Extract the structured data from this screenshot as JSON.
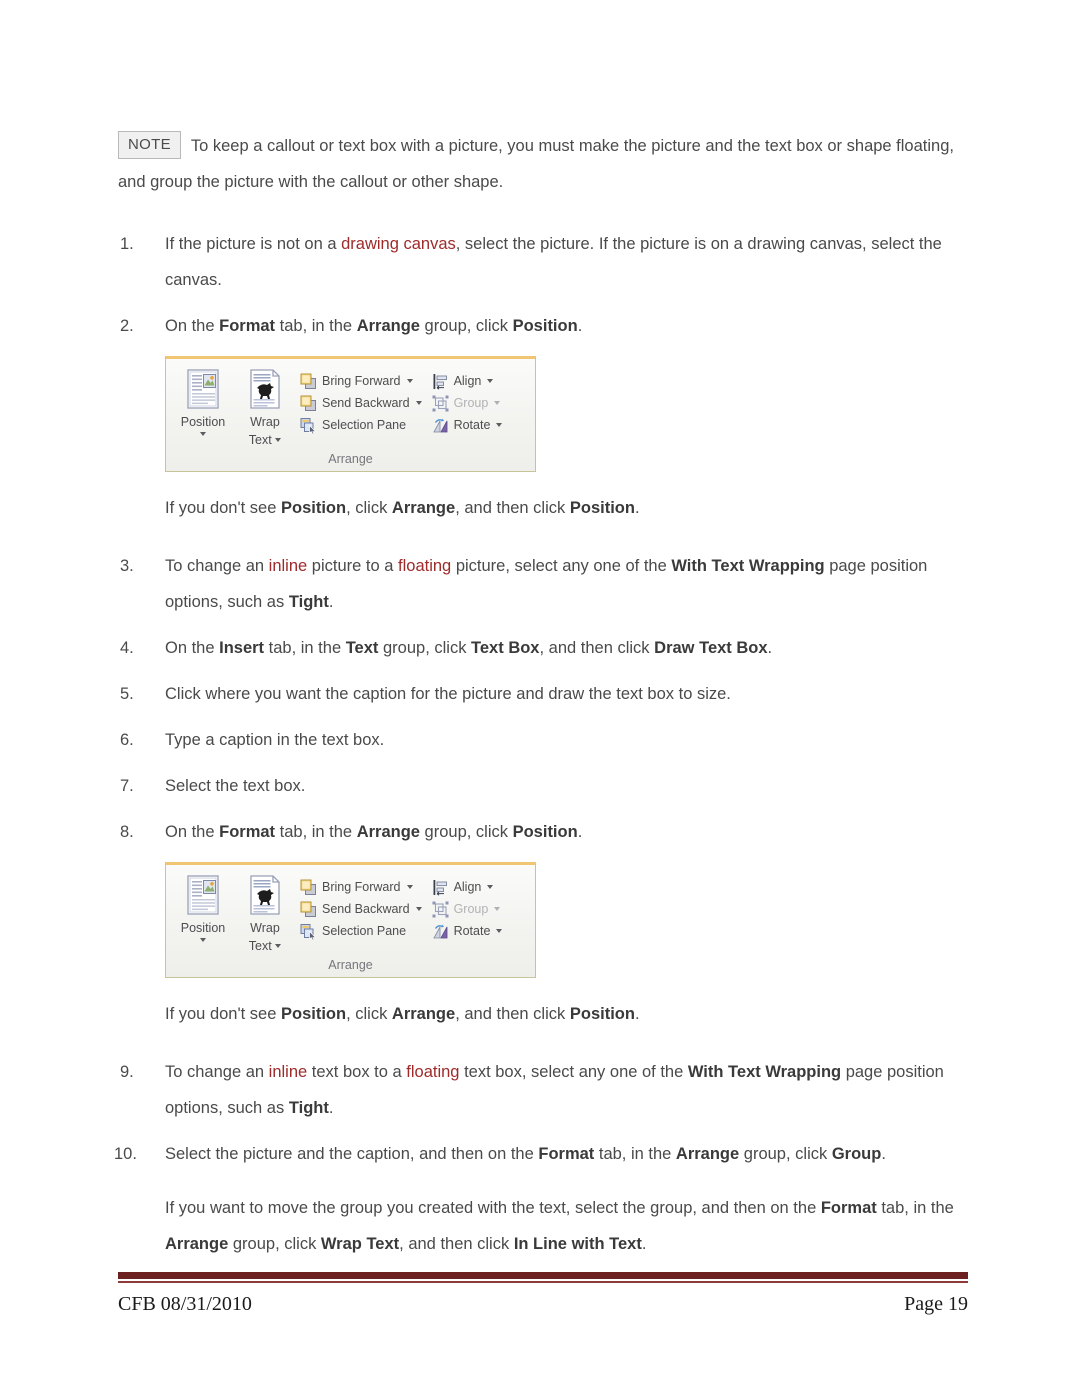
{
  "document": {
    "note": {
      "badge": "NOTE",
      "text": "To keep a callout or text box with a picture, you must make the picture and the text box or shape floating, and group the picture with the callout or other shape."
    },
    "steps": [
      {
        "number": "1.",
        "parts": [
          {
            "t": "If the picture is not on a ",
            "s": "normal"
          },
          {
            "t": "drawing canvas",
            "s": "link"
          },
          {
            "t": ", select the picture. If the picture is on a drawing canvas, select the canvas.",
            "s": "normal"
          }
        ]
      },
      {
        "number": "2.",
        "parts": [
          {
            "t": "On the ",
            "s": "normal"
          },
          {
            "t": "Format",
            "s": "bold"
          },
          {
            "t": " tab, in the ",
            "s": "normal"
          },
          {
            "t": "Arrange",
            "s": "bold"
          },
          {
            "t": " group, click ",
            "s": "normal"
          },
          {
            "t": "Position",
            "s": "bold"
          },
          {
            "t": ".",
            "s": "normal"
          }
        ]
      },
      {
        "number": "3.",
        "parts": [
          {
            "t": "To change an ",
            "s": "normal"
          },
          {
            "t": "inline",
            "s": "link"
          },
          {
            "t": " picture to a ",
            "s": "normal"
          },
          {
            "t": "floating",
            "s": "link"
          },
          {
            "t": " picture, select any one of the ",
            "s": "normal"
          },
          {
            "t": "With Text Wrapping",
            "s": "bold"
          },
          {
            "t": " page position options, such as ",
            "s": "normal"
          },
          {
            "t": "Tight",
            "s": "bold"
          },
          {
            "t": ".",
            "s": "normal"
          }
        ]
      },
      {
        "number": "4.",
        "parts": [
          {
            "t": "On the ",
            "s": "normal"
          },
          {
            "t": "Insert",
            "s": "bold"
          },
          {
            "t": " tab, in the ",
            "s": "normal"
          },
          {
            "t": "Text",
            "s": "bold"
          },
          {
            "t": " group, click ",
            "s": "normal"
          },
          {
            "t": "Text Box",
            "s": "bold"
          },
          {
            "t": ", and then click ",
            "s": "normal"
          },
          {
            "t": "Draw Text Box",
            "s": "bold"
          },
          {
            "t": ".",
            "s": "normal"
          }
        ]
      },
      {
        "number": "5.",
        "parts": [
          {
            "t": "Click where you want the caption for the picture and draw the text box to size.",
            "s": "normal"
          }
        ]
      },
      {
        "number": "6.",
        "parts": [
          {
            "t": "Type a caption in the text box.",
            "s": "normal"
          }
        ]
      },
      {
        "number": "7.",
        "parts": [
          {
            "t": "Select the text box.",
            "s": "normal"
          }
        ]
      },
      {
        "number": "8.",
        "parts": [
          {
            "t": "On the ",
            "s": "normal"
          },
          {
            "t": "Format",
            "s": "bold"
          },
          {
            "t": " tab, in the ",
            "s": "normal"
          },
          {
            "t": "Arrange",
            "s": "bold"
          },
          {
            "t": " group, click ",
            "s": "normal"
          },
          {
            "t": "Position",
            "s": "bold"
          },
          {
            "t": ".",
            "s": "normal"
          }
        ]
      },
      {
        "number": "9.",
        "parts": [
          {
            "t": "To change an ",
            "s": "normal"
          },
          {
            "t": "inline",
            "s": "link"
          },
          {
            "t": " text box to a ",
            "s": "normal"
          },
          {
            "t": "floating",
            "s": "link"
          },
          {
            "t": " text box, select any one of the ",
            "s": "normal"
          },
          {
            "t": "With Text Wrapping",
            "s": "bold"
          },
          {
            "t": " page position options, such as ",
            "s": "normal"
          },
          {
            "t": "Tight",
            "s": "bold"
          },
          {
            "t": ".",
            "s": "normal"
          }
        ]
      },
      {
        "number": "10.",
        "parts": [
          {
            "t": "Select the picture and the caption, and then on the ",
            "s": "normal"
          },
          {
            "t": "Format",
            "s": "bold"
          },
          {
            "t": " tab, in the ",
            "s": "normal"
          },
          {
            "t": "Arrange",
            "s": "bold"
          },
          {
            "t": " group, click ",
            "s": "normal"
          },
          {
            "t": "Group",
            "s": "bold"
          },
          {
            "t": ".",
            "s": "normal"
          }
        ]
      }
    ],
    "tip_position_1": [
      {
        "t": "If you don't see ",
        "s": "normal"
      },
      {
        "t": "Position",
        "s": "bold"
      },
      {
        "t": ", click ",
        "s": "normal"
      },
      {
        "t": "Arrange",
        "s": "bold"
      },
      {
        "t": ", and then click ",
        "s": "normal"
      },
      {
        "t": "Position",
        "s": "bold"
      },
      {
        "t": ".",
        "s": "normal"
      }
    ],
    "tip_position_2": [
      {
        "t": "If you don't see ",
        "s": "normal"
      },
      {
        "t": "Position",
        "s": "bold"
      },
      {
        "t": ", click ",
        "s": "normal"
      },
      {
        "t": "Arrange",
        "s": "bold"
      },
      {
        "t": ", and then click ",
        "s": "normal"
      },
      {
        "t": "Position",
        "s": "bold"
      },
      {
        "t": ".",
        "s": "normal"
      }
    ],
    "closing_note": [
      {
        "t": "If you want to move the group you created with the text, select the group, and then on the ",
        "s": "normal"
      },
      {
        "t": "Format",
        "s": "bold"
      },
      {
        "t": " tab, in the ",
        "s": "normal"
      },
      {
        "t": "Arrange",
        "s": "bold"
      },
      {
        "t": " group, click ",
        "s": "normal"
      },
      {
        "t": "Wrap Text",
        "s": "bold"
      },
      {
        "t": ", and then click ",
        "s": "normal"
      },
      {
        "t": "In Line with Text",
        "s": "bold"
      },
      {
        "t": ".",
        "s": "normal"
      }
    ]
  },
  "ribbon": {
    "group_title": "Arrange",
    "big_buttons": [
      {
        "label_line1": "Position",
        "label_line2": "",
        "icon": "position-icon",
        "has_caret": true
      },
      {
        "label_line1": "Wrap",
        "label_line2": "Text",
        "icon": "wrap-text-icon",
        "has_caret": true
      }
    ],
    "column_a": [
      {
        "label": "Bring Forward",
        "icon": "bring-forward-icon",
        "caret": true,
        "disabled": false
      },
      {
        "label": "Send Backward",
        "icon": "send-backward-icon",
        "caret": true,
        "disabled": false
      },
      {
        "label": "Selection Pane",
        "icon": "selection-pane-icon",
        "caret": false,
        "disabled": false
      }
    ],
    "column_b": [
      {
        "label": "Align",
        "icon": "align-icon",
        "caret": true,
        "disabled": false
      },
      {
        "label": "Group",
        "icon": "group-icon",
        "caret": true,
        "disabled": true
      },
      {
        "label": "Rotate",
        "icon": "rotate-icon",
        "caret": true,
        "disabled": false
      }
    ],
    "colors": {
      "top_border": "#f0c674",
      "border": "#c8c49a",
      "label": "#4e4e50",
      "disabled_label": "#b2b2b6"
    }
  },
  "footer": {
    "left": "CFB 08/31/2010",
    "right": "Page 19",
    "rule_color": "#6d2020"
  }
}
